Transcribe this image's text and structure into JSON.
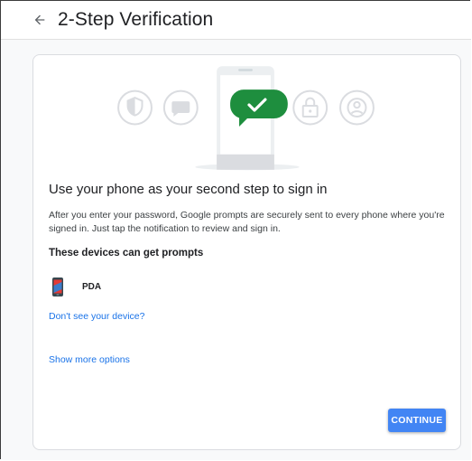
{
  "header": {
    "title": "2-Step Verification",
    "back_icon": "arrow-back-icon"
  },
  "hero": {
    "icons": [
      "shield-icon",
      "chat-bubble-icon",
      "phone-with-check-icon",
      "lock-icon",
      "account-circle-icon"
    ],
    "accent_green": "#1e8e3e"
  },
  "main": {
    "heading": "Use your phone as your second step to sign in",
    "description": "After you enter your password, Google prompts are securely sent to every phone where you're signed in. Just tap the notification to review and sign in.",
    "devices_heading": "These devices can get prompts",
    "devices": [
      {
        "name": "PDA",
        "icon": "phone-icon"
      }
    ],
    "no_device_link": "Don't see your device?",
    "more_options_link": "Show more options",
    "continue_label": "CONTINUE"
  },
  "colors": {
    "link": "#1a73e8",
    "button": "#4285f4",
    "circle_icon": "#dadce0"
  }
}
